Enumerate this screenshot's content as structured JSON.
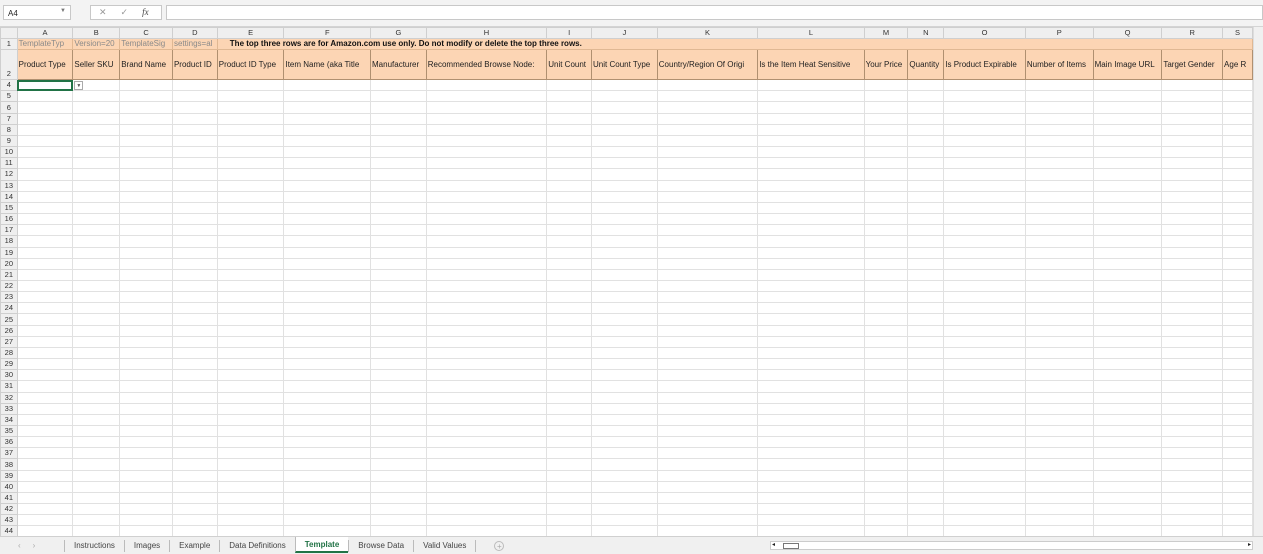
{
  "formula_bar": {
    "name_box": "A4",
    "cancel_icon": "✕",
    "enter_icon": "✓",
    "fx_label": "fx",
    "formula": ""
  },
  "columns": [
    "A",
    "B",
    "C",
    "D",
    "E",
    "F",
    "G",
    "H",
    "I",
    "J",
    "K",
    "L",
    "M",
    "N",
    "O",
    "P",
    "Q",
    "R",
    "S"
  ],
  "row1": [
    "TemplateTyp",
    "Version=20",
    "TemplateSig",
    "settings=al"
  ],
  "notice": "The top three rows are for Amazon.com use only. Do not modify or delete the top three rows.",
  "headers": [
    "Product Type",
    "Seller SKU",
    "Brand Name",
    "Product ID",
    "Product ID Type",
    "Item Name (aka Title",
    "Manufacturer",
    "Recommended Browse Node:",
    "Unit Count",
    "Unit Count Type",
    "Country/Region Of Origi",
    "Is the Item Heat Sensitive",
    "Your Price",
    "Quantity",
    "Is Product Expirable",
    "Number of Items",
    "Main Image URL",
    "Target Gender",
    "Age R"
  ],
  "row_numbers_header": [
    "1",
    "2"
  ],
  "data_rows_start": 4,
  "data_rows_end": 44,
  "sheet_tabs": [
    "Instructions",
    "Images",
    "Example",
    "Data Definitions",
    "Template",
    "Browse Data",
    "Valid Values"
  ],
  "active_tab": "Template",
  "add_sheet": "+"
}
